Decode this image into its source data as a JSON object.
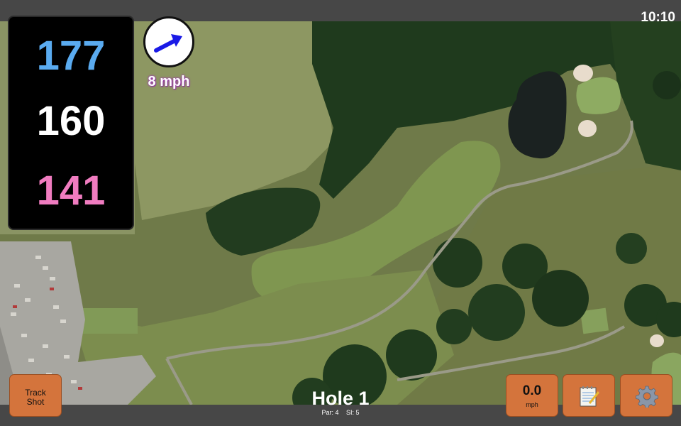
{
  "status_bar": {
    "time": "10:10"
  },
  "distances": {
    "back": "177",
    "center": "160",
    "front": "141"
  },
  "wind": {
    "speed_label": "8 mph",
    "direction_icon": "arrow-icon"
  },
  "buttons": {
    "track_shot": {
      "line1": "Track",
      "line2": "Shot"
    },
    "speed": {
      "value": "0.0",
      "unit": "mph"
    },
    "notes_icon": "notepad-icon",
    "settings_icon": "gear-icon"
  },
  "hole": {
    "title": "Hole 1",
    "par": "Par: 4",
    "si": "SI: 5"
  },
  "colors": {
    "back_distance": "#5aabf0",
    "center_distance": "#ffffff",
    "front_distance": "#f07cc0",
    "button": "#d4743c"
  }
}
